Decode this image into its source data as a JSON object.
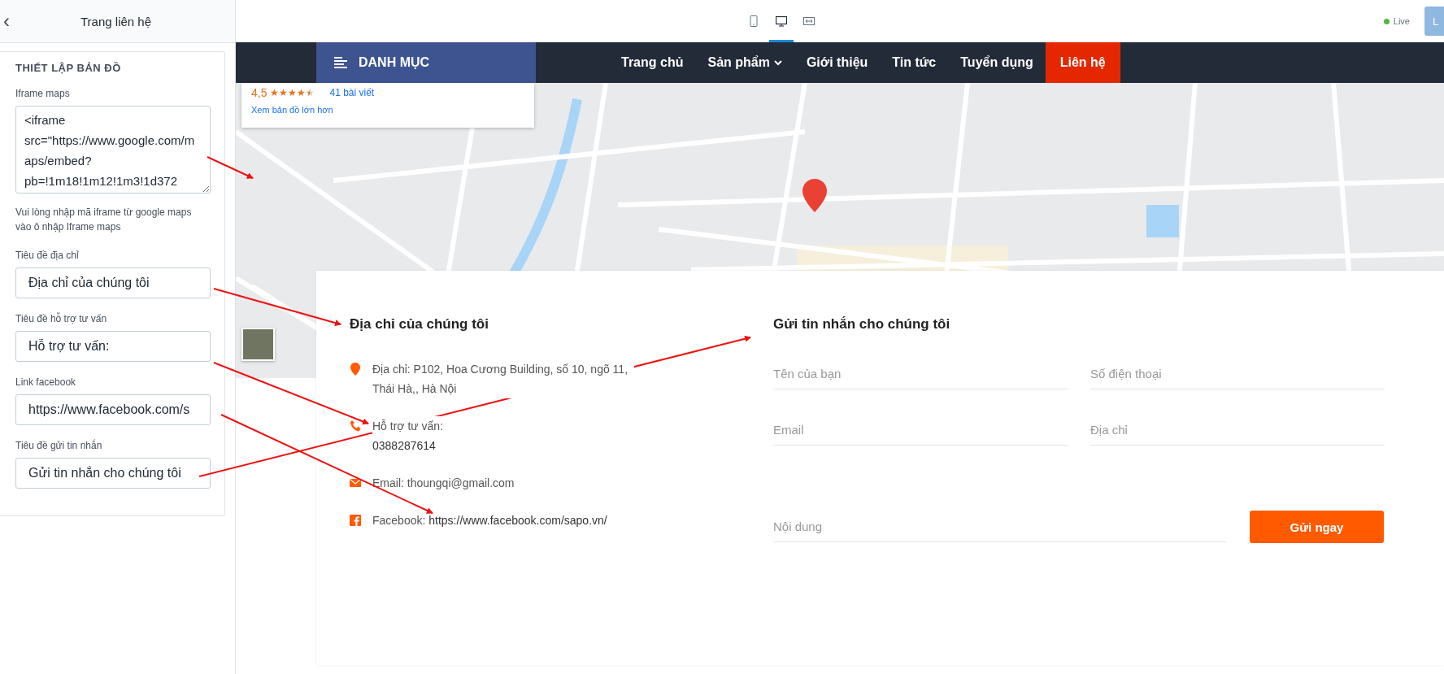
{
  "sidebar": {
    "back": "‹",
    "title": "Trang liên hệ",
    "section": {
      "title": "THIẾT LẬP BẢN ĐỒ",
      "fields": [
        {
          "kind": "textarea",
          "label": "Iframe maps",
          "value": "<iframe src=\"https://www.google.com/maps/embed?pb=!1m18!1m12!1m3!1d372",
          "help": "Vui lòng nhập mã iframe từ google maps vào ô nhập Iframe maps"
        },
        {
          "kind": "input",
          "label": "Tiêu đề địa chỉ",
          "value": "Địa chỉ của chúng tôi"
        },
        {
          "kind": "input",
          "label": "Tiêu đề hỗ trợ tư vấn",
          "value": "Hỗ trợ tư vấn:"
        },
        {
          "kind": "input",
          "label": "Link facebook",
          "value": "https://www.facebook.com/s"
        },
        {
          "kind": "input",
          "label": "Tiêu đề gửi tin nhắn",
          "value": "Gửi tin nhắn cho chúng tôi"
        }
      ]
    }
  },
  "toolbar": {
    "views": [
      {
        "kind": "mobile",
        "selected": false
      },
      {
        "kind": "desktop",
        "selected": true
      },
      {
        "kind": "full",
        "selected": false
      }
    ],
    "status": "Live",
    "button": "L"
  },
  "nav": {
    "category": "DANH MỤC",
    "items": [
      {
        "label": "Trang chủ",
        "dropdown": false,
        "selected": false
      },
      {
        "label": "Sản phẩm",
        "dropdown": true,
        "selected": false
      },
      {
        "label": "Giới thiệu",
        "dropdown": false,
        "selected": false
      },
      {
        "label": "Tin tức",
        "dropdown": false,
        "selected": false
      },
      {
        "label": "Tuyển dụng",
        "dropdown": false,
        "selected": false
      },
      {
        "label": "Liên hệ",
        "dropdown": false,
        "selected": true
      }
    ]
  },
  "map": {
    "rating": "4,5",
    "stars": 4.5,
    "reviews": "41 bài viết",
    "larger_map": "Xem bản đồ lớn hơn"
  },
  "contact": {
    "title": "Địa chỉ của chúng tôi",
    "items": [
      {
        "kind": "address",
        "text": "Địa chỉ: P102, Hoa Cương Building, số 10, ngõ 11, Thái Hà,, Hà Nội"
      },
      {
        "kind": "phone",
        "text": "Hỗ trợ tư vấn:",
        "value": "0388287614"
      },
      {
        "kind": "email",
        "text": "Email: thoungqi@gmail.com"
      },
      {
        "kind": "facebook",
        "text": "Facebook: ",
        "link": "https://www.facebook.com/sapo.vn/"
      }
    ]
  },
  "form": {
    "title": "Gửi tin nhắn cho chúng tôi",
    "fields": [
      {
        "placeholder": "Tên của bạn"
      },
      {
        "placeholder": "Số điện thoại"
      },
      {
        "placeholder": "Email"
      },
      {
        "placeholder": "Địa chỉ"
      }
    ],
    "message": {
      "placeholder": "Nội dung"
    },
    "submit": "Gửi ngay"
  }
}
